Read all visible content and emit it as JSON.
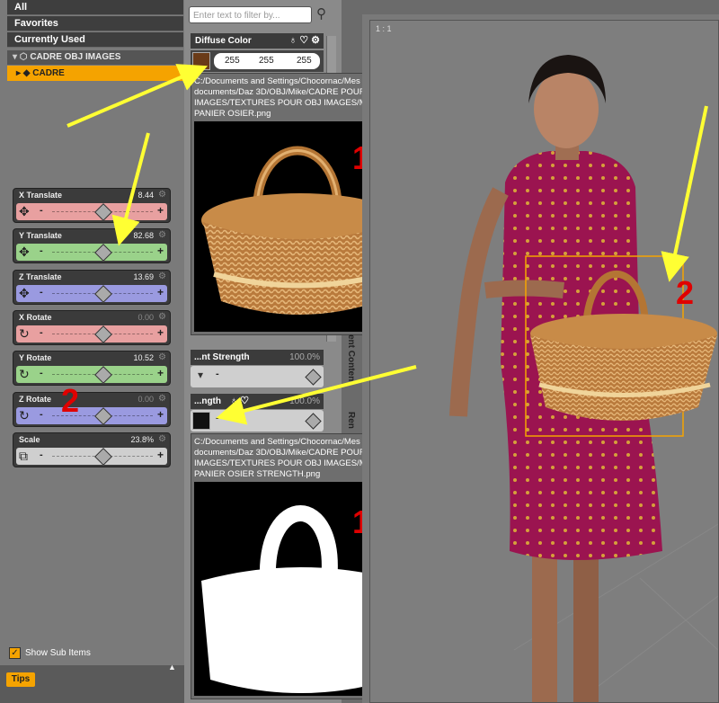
{
  "scene": {
    "all": "All",
    "favorites": "Favorites",
    "currently_used": "Currently Used",
    "group": "CADRE OBJ IMAGES",
    "selected_item": "CADRE",
    "show_sub_items": "Show Sub Items",
    "tips": "Tips"
  },
  "sliders": [
    {
      "label": "X Translate",
      "value": "8.44",
      "color": "#e8a0a0"
    },
    {
      "label": "Y Translate",
      "value": "82.68",
      "color": "#9ad28a"
    },
    {
      "label": "Z Translate",
      "value": "13.69",
      "color": "#9a9ae0"
    },
    {
      "label": "X Rotate",
      "value": "0.00",
      "color": "#e8a0a0"
    },
    {
      "label": "Y Rotate",
      "value": "10.52",
      "color": "#9ad28a"
    },
    {
      "label": "Z Rotate",
      "value": "0.00",
      "color": "#9a9ae0"
    },
    {
      "label": "Scale",
      "value": "23.8%",
      "color": "#cfcfcf"
    }
  ],
  "surfaces": {
    "filter_placeholder": "Enter text to filter by...",
    "diffuse_label": "Diffuse Color",
    "rgb": [
      "255",
      "255",
      "255"
    ],
    "tooltip1_path": "C:/Documents and Settings/Chocornac/Mes documents/Daz 3D/OBJ/Mike/CADRE POUR OBJ IMAGES/TEXTURES POUR OBJ IMAGES/Maps/ PANIER OSIER.png",
    "tooltip2_path": "C:/Documents and Settings/Chocornac/Mes documents/Daz 3D/OBJ/Mike/CADRE POUR OBJ IMAGES/TEXTURES POUR OBJ IMAGES/Maps/ PANIER OSIER STRENGTH.png",
    "strength_label": "...nt Strength",
    "strength_value": "100.0%",
    "length_label": "...ngth",
    "length_value": "100.0%",
    "tab_content": "ent Content",
    "tab_render": "Ren"
  },
  "viewport": {
    "ratio": "1 : 1"
  },
  "annotations": {
    "one": "1",
    "two": "2"
  }
}
